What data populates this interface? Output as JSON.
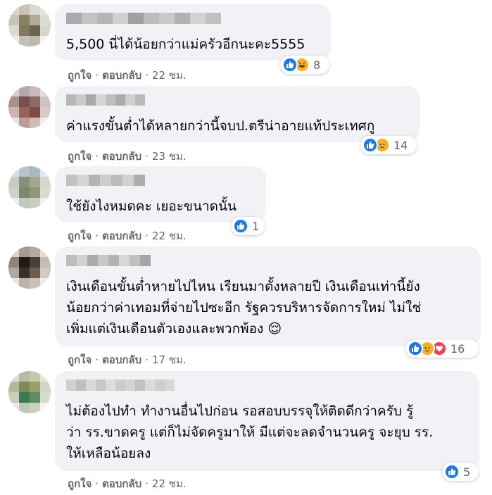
{
  "comments": [
    {
      "text": "5,500 นี่ได้น้อยกว่าแม่ครัวอีกนะคะ5555",
      "like_label": "ถูกใจ",
      "reply_label": "ตอบกลับ",
      "time": "22 ชม.",
      "reaction_count": "8",
      "reactions": [
        "like-icon",
        "haha-icon"
      ]
    },
    {
      "text": "ค่าแรงขั้นต่ำได้หลายกว่านี้จบป.ตรีน่าอายแท้ประเทศกู",
      "like_label": "ถูกใจ",
      "reply_label": "ตอบกลับ",
      "time": "23 ชม.",
      "reaction_count": "14",
      "reactions": [
        "like-icon",
        "sad-icon"
      ]
    },
    {
      "text": "ใช้ยังไงหมดคะ เยอะขนาดนั้น",
      "like_label": "ถูกใจ",
      "reply_label": "ตอบกลับ",
      "time": "22 ชม.",
      "reaction_count": "1",
      "reactions": [
        "like-icon"
      ]
    },
    {
      "text": "เงินเดือนขั้นต่ำหายไปไหน เรียนมาตั้งหลายปี เงินเดือนเท่านี้ยัง\nน้อยกว่าค่าเทอมที่จ่ายไปซะอีก รัฐควรบริหารจัดการใหม่ ไม่ใช่\nเพิ่มแต่เงินเดือนตัวเองและพวกพ้อง 😌",
      "like_label": "ถูกใจ",
      "reply_label": "ตอบกลับ",
      "time": "17 ชม.",
      "reaction_count": "16",
      "reactions": [
        "like-icon",
        "sad-icon",
        "love-icon"
      ]
    },
    {
      "text": "ไม่ต้องไปทำ ทำงานอื่นไปก่อน รอสอบบรรจุให้ติดดีกว่าครับ รู้\nว่า รร.ขาดครู แต่ก็ไม่จัดครูมาให้ มีแต่จะลดจำนวนครู จะยุบ รร.\nให้เหลือน้อยลง",
      "like_label": "ถูกใจ",
      "reply_label": "ตอบกลับ",
      "time": "22 ชม.",
      "reaction_count": "5",
      "reactions": [
        "like-icon"
      ]
    }
  ],
  "colors": {
    "bubble": "#f0f2f5",
    "meta_text": "#65676b",
    "like_blue": "#1877f2",
    "emoji_yellow": "#f7b125",
    "love_red": "#f33e58"
  }
}
